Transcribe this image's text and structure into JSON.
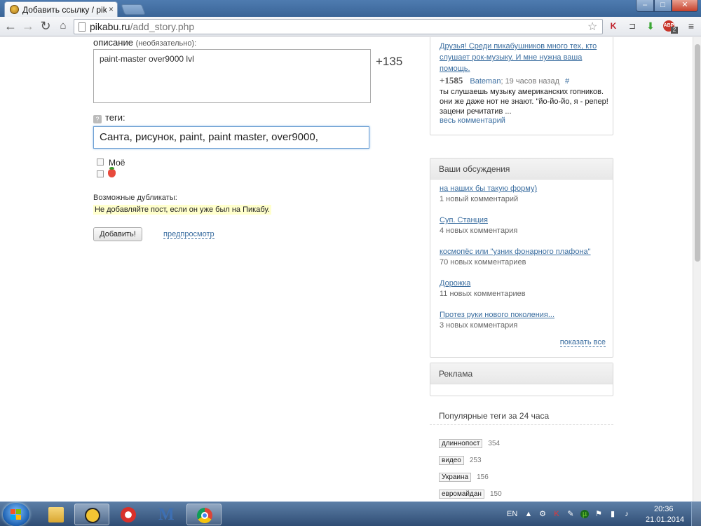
{
  "browser": {
    "tab_title": "Добавить ссылку / pikabu.ru",
    "tab_close": "×",
    "url_domain": "pikabu.ru",
    "url_path": "/add_story.php",
    "abp_badge": "2"
  },
  "form": {
    "description_label": "описание",
    "description_hint": "(необязательно):",
    "description_value": "paint-master over9000 lvl",
    "counter": "+135",
    "tags_label": "теги:",
    "tags_help": "?",
    "tags_value": "Санта, рисунок, paint, paint master, over9000,",
    "checkbox_mine": "Моё",
    "duplicates_label": "Возможные дубликаты:",
    "duplicates_warning": "Не добавляйте пост, если он уже был на Пикабу.",
    "submit_button": "Добавить!",
    "preview_link": "предпросмотр"
  },
  "sidebar": {
    "top_comment": {
      "title": "Друзья! Среди пикабушников много тех, кто слушает рок-музыку. И мне нужна ваша помощь.",
      "rating": "+1585",
      "author": "Bateman",
      "time": "; 19 часов назад",
      "hash": "#",
      "text": "ты слушаешь музыку американских гопников. они же даже нот не знают. \"йо-йо-йо, я - репер! зацени речитатив ...",
      "all_link": "весь комментарий"
    },
    "discussions": {
      "title": "Ваши обсуждения",
      "items": [
        {
          "title": "на наших бы такую форму)",
          "count": "1 новый комментарий"
        },
        {
          "title": "Суп. Станция",
          "count": "4 новых комментария"
        },
        {
          "title": "космопёс или \"узник фонарного плафона\"",
          "count": "70 новых комментариев"
        },
        {
          "title": "Дорожка",
          "count": "11 новых комментариев"
        },
        {
          "title": "Протез руки нового поколения...",
          "count": "3 новых комментария"
        }
      ],
      "show_all": "показать все"
    },
    "ads": {
      "title": "Реклама"
    },
    "popular_tags": {
      "title": "Популярные теги за 24 часа",
      "items": [
        {
          "tag": "длиннопост",
          "count": "354"
        },
        {
          "tag": "видео",
          "count": "253"
        },
        {
          "tag": "Украина",
          "count": "156"
        },
        {
          "tag": "евромайдан",
          "count": "150"
        }
      ]
    }
  },
  "taskbar": {
    "language": "EN",
    "time": "20:36",
    "date": "21.01.2014"
  }
}
